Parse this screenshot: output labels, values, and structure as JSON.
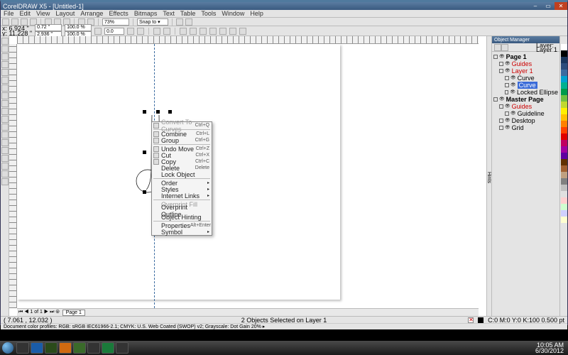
{
  "title": "CorelDRAW X5 - [Untitled-1]",
  "menus": [
    "File",
    "Edit",
    "View",
    "Layout",
    "Arrange",
    "Effects",
    "Bitmaps",
    "Text",
    "Table",
    "Tools",
    "Window",
    "Help"
  ],
  "coords": {
    "x": "x: 6.924 \"",
    "y": "y: 11.228 \""
  },
  "size": {
    "w": "0.72 \"",
    "h": "2.936 \""
  },
  "scale": {
    "x": "100.0 %",
    "y": "100.0 %"
  },
  "rotation": "0.0",
  "zoom": "73%",
  "snap": "Snap to ▾",
  "context_menu": [
    {
      "label": "Convert To Curves",
      "shortcut": "Ctrl+Q",
      "icon": true,
      "disabled": true
    },
    {
      "sep": true
    },
    {
      "label": "Combine",
      "shortcut": "Ctrl+L",
      "icon": true
    },
    {
      "label": "Group",
      "shortcut": "Ctrl+G",
      "icon": true
    },
    {
      "sep": true
    },
    {
      "label": "Undo Move",
      "shortcut": "Ctrl+Z",
      "icon": true
    },
    {
      "label": "Cut",
      "shortcut": "Ctrl+X",
      "icon": true
    },
    {
      "label": "Copy",
      "shortcut": "Ctrl+C",
      "icon": true
    },
    {
      "label": "Delete",
      "shortcut": "Delete"
    },
    {
      "label": "Lock Object"
    },
    {
      "sep": true
    },
    {
      "label": "Order",
      "submenu": true
    },
    {
      "label": "Styles",
      "submenu": true
    },
    {
      "label": "Internet Links",
      "submenu": true
    },
    {
      "sep": true
    },
    {
      "label": "Overprint Fill",
      "disabled": true
    },
    {
      "label": "Overprint Outline"
    },
    {
      "label": "Object Hinting"
    },
    {
      "sep": true
    },
    {
      "label": "Properties",
      "shortcut": "Alt+Enter"
    },
    {
      "label": "Symbol",
      "submenu": true
    }
  ],
  "docker": {
    "title": "Object Manager",
    "layermeta": "Layer:\nLayer 1",
    "tree": [
      {
        "l": 0,
        "label": "Page 1",
        "bold": true
      },
      {
        "l": 1,
        "label": "Guides",
        "color": "#c00"
      },
      {
        "l": 1,
        "label": "Layer 1",
        "color": "#c00",
        "sel": false
      },
      {
        "l": 2,
        "label": "Curve",
        "icon": "curve"
      },
      {
        "l": 2,
        "label": "Curve",
        "icon": "curve",
        "hl": true
      },
      {
        "l": 2,
        "label": "Locked Ellipse",
        "icon": "ellipse"
      },
      {
        "l": 0,
        "label": "Master Page",
        "bold": true
      },
      {
        "l": 1,
        "label": "Guides",
        "color": "#c00"
      },
      {
        "l": 2,
        "label": "Guideline"
      },
      {
        "l": 1,
        "label": "Desktop"
      },
      {
        "l": 1,
        "label": "Grid"
      }
    ]
  },
  "page_tabs": {
    "nav": "⏮ ◀ 1 of 1 ▶ ⏭ ⊕",
    "page": "Page 1"
  },
  "status": {
    "cursor": "( 7.061 , 12.032 )",
    "selection": "2 Objects Selected on Layer 1",
    "fill": "C:0 M:0 Y:0 K:100  0.500 pt"
  },
  "infobar": "Document color profiles: RGB: sRGB IEC61966-2.1; CMYK: U.S. Web Coated (SWOP) v2; Grayscale: Dot Gain 20% ▸",
  "palette": [
    "#ffffff",
    "#000000",
    "#1a355c",
    "#2d4c7c",
    "#3b6aa0",
    "#00a0d0",
    "#00b090",
    "#009a4a",
    "#70c040",
    "#c0d830",
    "#fff000",
    "#ffc000",
    "#ff8000",
    "#ff4000",
    "#e00000",
    "#c00060",
    "#a000a0",
    "#6000a0",
    "#603000",
    "#a06030",
    "#c0a080",
    "#808080",
    "#c0c0c0",
    "#e0e0e0",
    "#ffd0d0",
    "#d0ffd0",
    "#d0d0ff",
    "#ffffd0"
  ],
  "tray": {
    "time": "10:05 AM",
    "date": "6/30/2012"
  }
}
